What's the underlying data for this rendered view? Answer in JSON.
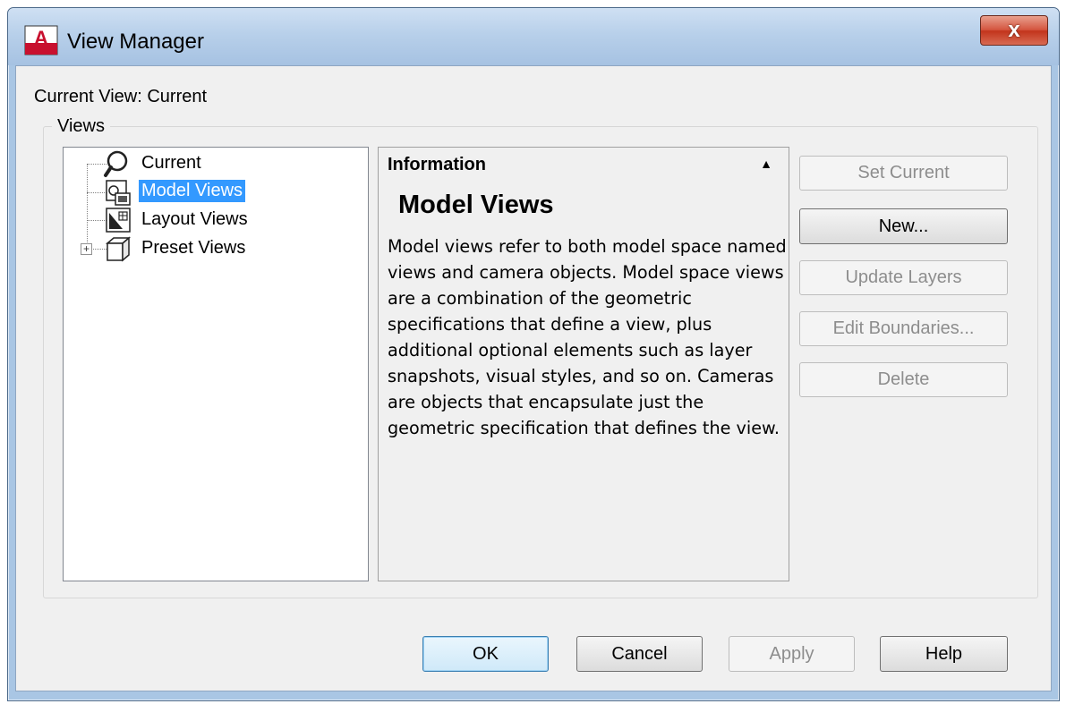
{
  "window": {
    "title": "View Manager",
    "app_icon_letter": "A",
    "close_glyph": "x"
  },
  "current_view": "Current View: Current",
  "views_group": {
    "label": "Views",
    "tree": [
      {
        "label": "Current",
        "icon": "magnifier-icon",
        "selected": false,
        "expandable": false
      },
      {
        "label": "Model Views",
        "icon": "model-views-icon",
        "selected": true,
        "expandable": false
      },
      {
        "label": "Layout Views",
        "icon": "layout-views-icon",
        "selected": false,
        "expandable": false
      },
      {
        "label": "Preset Views",
        "icon": "cube-icon",
        "selected": false,
        "expandable": true,
        "expander_glyph": "+"
      }
    ]
  },
  "info": {
    "header": "Information",
    "collapse_glyph": "▲",
    "title": "Model Views",
    "body": "Model views refer to both model space named views and camera objects. Model space views are a combination of the geometric specifications that define a view, plus additional optional elements such as layer snapshots, visual styles, and so on. Cameras are objects that encapsulate just the geometric specification that defines the view."
  },
  "side_buttons": [
    {
      "label": "Set Current",
      "enabled": false
    },
    {
      "label": "New...",
      "enabled": true
    },
    {
      "label": "Update Layers",
      "enabled": false
    },
    {
      "label": "Edit Boundaries...",
      "enabled": false
    },
    {
      "label": "Delete",
      "enabled": false
    }
  ],
  "footer_buttons": [
    {
      "label": "OK",
      "enabled": true,
      "default": true
    },
    {
      "label": "Cancel",
      "enabled": true,
      "default": false
    },
    {
      "label": "Apply",
      "enabled": false,
      "default": false
    },
    {
      "label": "Help",
      "enabled": true,
      "default": false
    }
  ],
  "colors": {
    "selection": "#3399ff",
    "close_button": "#c2341c",
    "title_bar": "#b8d0ea"
  }
}
